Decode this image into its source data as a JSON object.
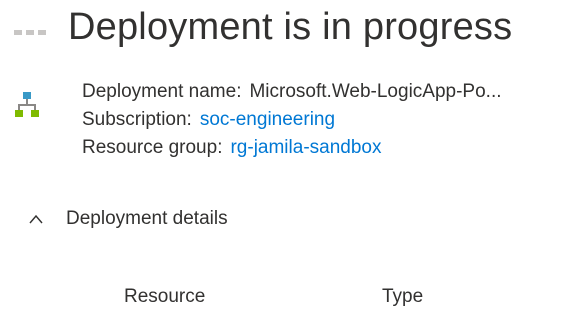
{
  "header": {
    "title": "Deployment is in progress"
  },
  "deployment": {
    "icon": "resource-group-icon",
    "name_label": "Deployment name:",
    "name_value": "Microsoft.Web-LogicApp-Po...",
    "subscription_label": "Subscription:",
    "subscription_value": "soc-engineering",
    "resource_group_label": "Resource group:",
    "resource_group_value": "rg-jamila-sandbox"
  },
  "details": {
    "toggle_label": "Deployment details",
    "expanded": true,
    "columns": [
      "Resource",
      "Type"
    ]
  },
  "colors": {
    "link": "#0078d4",
    "icon_blue": "#3999c6",
    "icon_green": "#7fba00"
  }
}
